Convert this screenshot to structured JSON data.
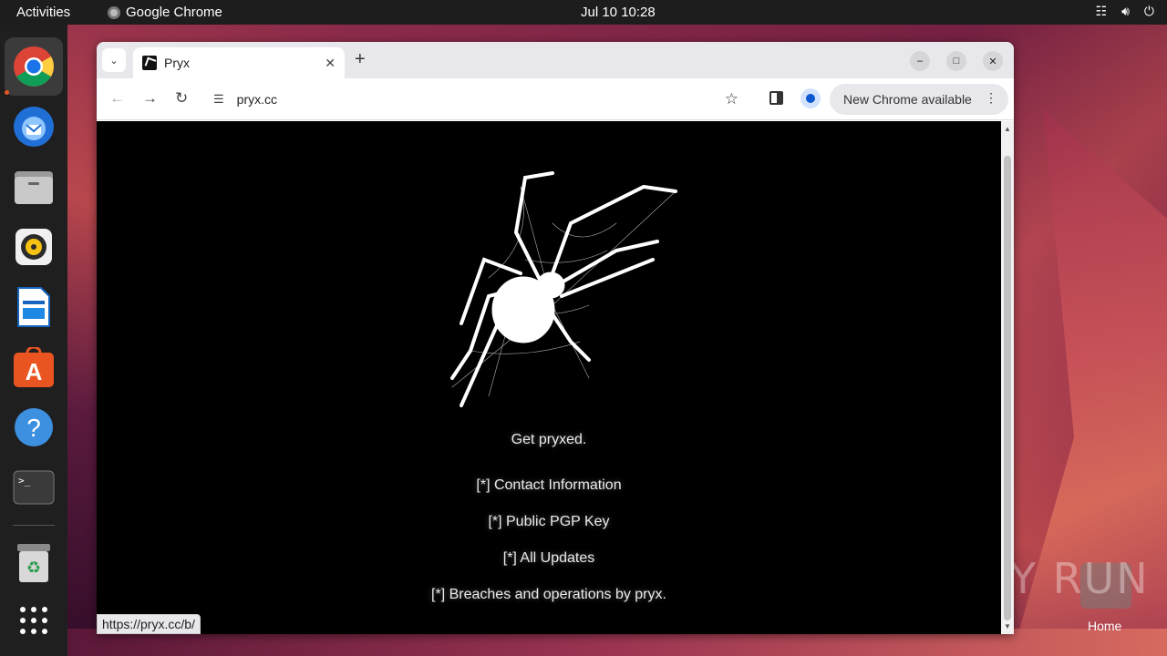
{
  "topbar": {
    "activities": "Activities",
    "app_name": "Google Chrome",
    "clock": "Jul 10  10:28"
  },
  "dock": {
    "items": [
      "chrome-icon",
      "thunderbird-icon",
      "files-icon",
      "rhythmbox-icon",
      "writer-icon",
      "app-center-icon",
      "help-icon",
      "terminal-icon",
      "trash-icon",
      "show-apps-icon"
    ]
  },
  "browser": {
    "tab_title": "Pryx",
    "url": "pryx.cc",
    "update_label": "New Chrome available",
    "status_url": "https://pryx.cc/b/"
  },
  "page": {
    "tagline": "Get pryxed.",
    "links": [
      "[*] Contact Information",
      "[*] Public PGP Key",
      "[*] All Updates",
      "[*] Breaches and operations by pryx."
    ]
  },
  "desktop": {
    "watermark": "ANY RUN",
    "home_label": "Home"
  },
  "colors": {
    "page_bg": "#000000",
    "page_text": "#eaeaea",
    "accent": "#e95420"
  }
}
